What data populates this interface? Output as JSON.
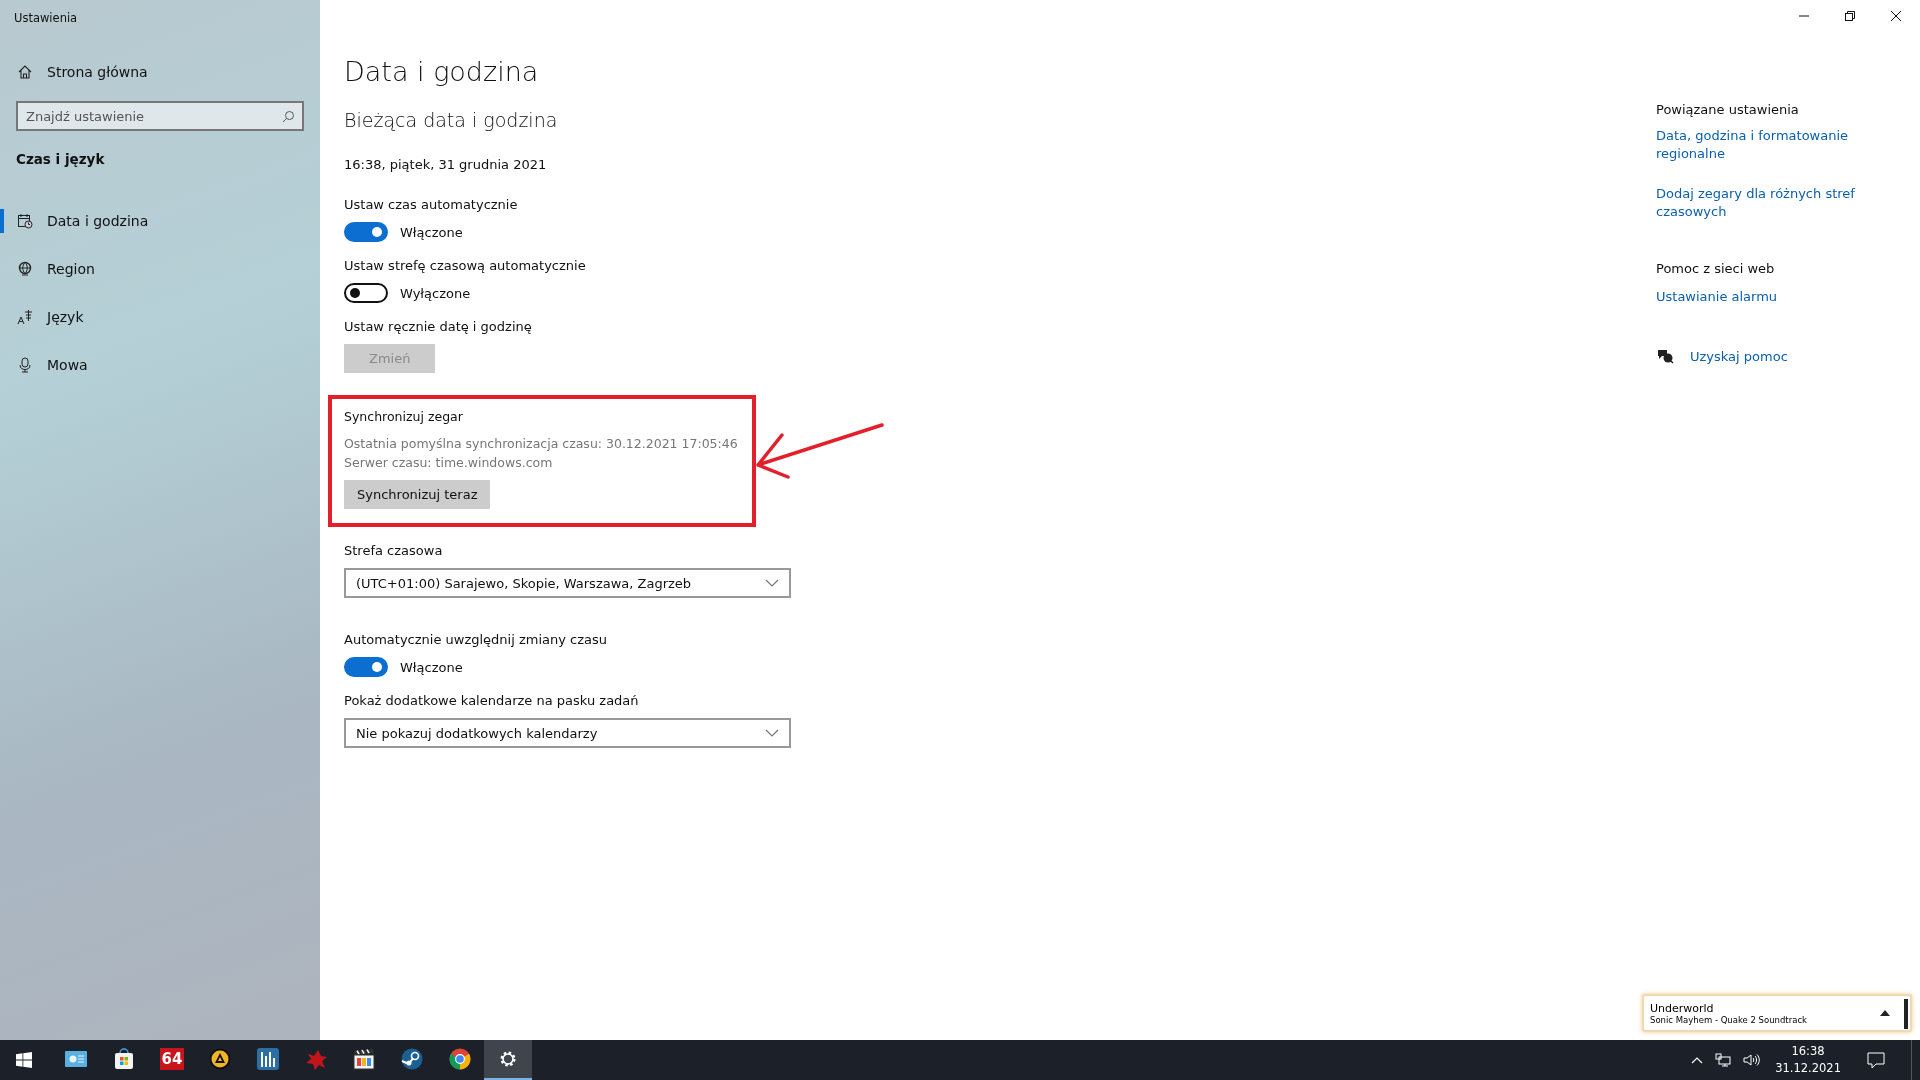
{
  "window": {
    "title": "Ustawienia"
  },
  "sidebar": {
    "home": "Strona główna",
    "search": {
      "placeholder": "Znajdź ustawienie"
    },
    "section": "Czas i język",
    "items": [
      {
        "label": "Data i godzina",
        "selected": true
      },
      {
        "label": "Region",
        "selected": false
      },
      {
        "label": "Język",
        "selected": false
      },
      {
        "label": "Mowa",
        "selected": false
      }
    ]
  },
  "main": {
    "title": "Data i godzina",
    "subtitle": "Bieżąca data i godzina",
    "current": "16:38, piątek, 31 grudnia 2021",
    "settings": [
      {
        "kind": "toggle",
        "label": "Ustaw czas automatycznie",
        "on": true,
        "state": "Włączone"
      },
      {
        "kind": "toggle",
        "label": "Ustaw strefę czasową automatycznie",
        "on": false,
        "state": "Wyłączone"
      },
      {
        "kind": "button",
        "label": "Ustaw ręcznie datę i godzinę",
        "button": "Zmień",
        "disabled": true
      }
    ],
    "sync": {
      "highlighted": true,
      "label": "Synchronizuj zegar",
      "last": "Ostatnia pomyślna synchronizacja czasu: 30.12.2021 17:05:46",
      "server": "Serwer czasu: time.windows.com",
      "button": "Synchronizuj teraz"
    },
    "settings2": [
      {
        "kind": "dropdown",
        "label": "Strefa czasowa",
        "value": "(UTC+01:00) Sarajewo, Skopie, Warszawa, Zagrzeb"
      },
      {
        "kind": "toggle",
        "label": "Automatycznie uwzględnij zmiany czasu",
        "on": true,
        "state": "Włączone"
      },
      {
        "kind": "dropdown",
        "label": "Pokaż dodatkowe kalendarze na pasku zadań",
        "value": "Nie pokazuj dodatkowych kalendarzy"
      }
    ]
  },
  "related": {
    "title": "Powiązane ustawienia",
    "links": [
      "Data, godzina i formatowanie regionalne",
      "Dodaj zegary dla różnych stref czasowych"
    ],
    "help_title": "Pomoc z sieci web",
    "help_links": [
      "Ustawianie alarmu"
    ],
    "get_help": "Uzyskaj pomoc"
  },
  "media": {
    "artist": "Underworld",
    "track": "Sonic Mayhem - Quake 2 Soundtrack"
  },
  "taskbar": {
    "apps": [
      {
        "kind": "explorer",
        "selected": false
      },
      {
        "kind": "store",
        "selected": false
      },
      {
        "kind": "aida",
        "label": "64",
        "selected": false
      },
      {
        "kind": "aimp",
        "selected": false
      },
      {
        "kind": "equalizer",
        "selected": false
      },
      {
        "kind": "bug",
        "selected": false
      },
      {
        "kind": "clapper",
        "selected": false
      },
      {
        "kind": "steam",
        "selected": false
      },
      {
        "kind": "chrome",
        "selected": false
      },
      {
        "kind": "gear",
        "selected": true
      }
    ],
    "time": "16:38",
    "date": "31.12.2021"
  }
}
